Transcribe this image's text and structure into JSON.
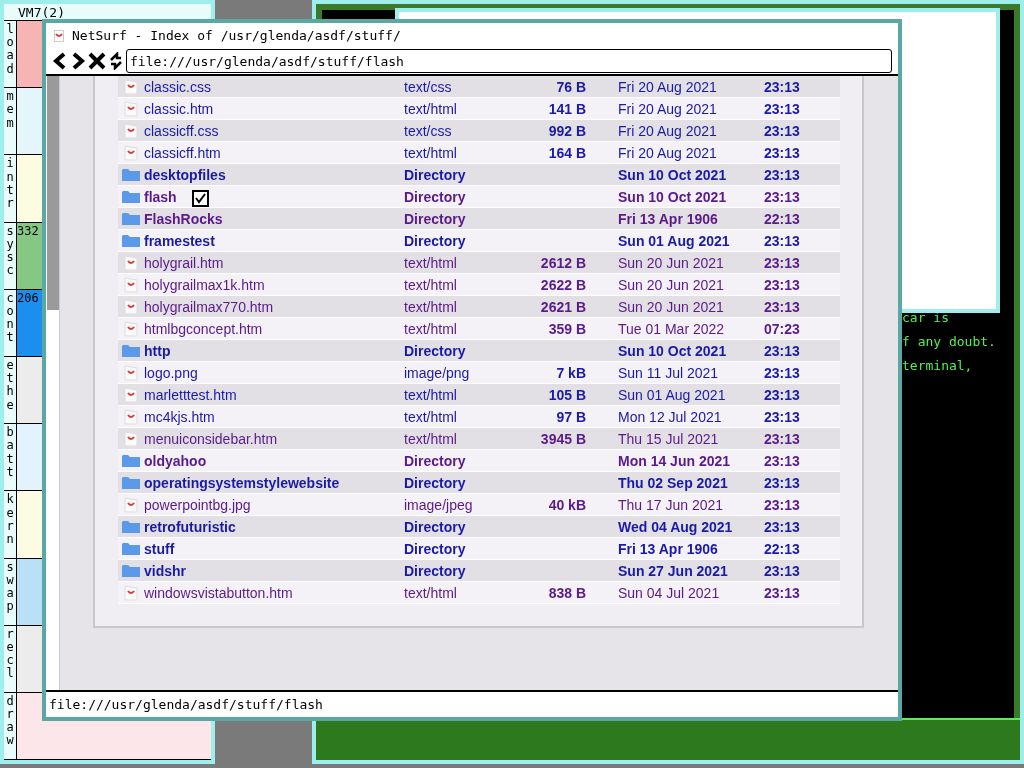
{
  "stats_window": {
    "title": "VM7(2)",
    "meters": [
      {
        "label": "load",
        "color": "#f7b4b4"
      },
      {
        "label": "mem",
        "color": "#e4f6fc"
      },
      {
        "label": "intr",
        "color": "#fdfbe0"
      },
      {
        "label": "sysc",
        "color": "#84c884",
        "reading": "332"
      },
      {
        "label": "cont",
        "color": "#1a8ff0",
        "reading": "206"
      },
      {
        "label": "ethe",
        "color": "#ececec"
      },
      {
        "label": "batt",
        "color": "#e2f3fd"
      },
      {
        "label": "kern",
        "color": "#fdfbe4"
      },
      {
        "label": "swap",
        "color": "#b9e0f7"
      },
      {
        "label": "recl",
        "color": "#ececec"
      },
      {
        "label": "draw",
        "color": "#fde6ea"
      }
    ]
  },
  "terminal": {
    "lines": [
      "car is",
      "f any doubt.",
      "terminal,"
    ]
  },
  "browser": {
    "title": "NetSurf - Index of /usr/glenda/asdf/stuff/",
    "url": "file:///usr/glenda/asdf/stuff/flash",
    "rows": [
      {
        "kind": "file",
        "name": "classic.css",
        "type": "text/css",
        "size": "76 B",
        "date": "Fri 20 Aug 2021",
        "time": "23:13",
        "visited": false
      },
      {
        "kind": "file",
        "name": "classic.htm",
        "type": "text/html",
        "size": "141 B",
        "date": "Fri 20 Aug 2021",
        "time": "23:13",
        "visited": false
      },
      {
        "kind": "file",
        "name": "classicff.css",
        "type": "text/css",
        "size": "992 B",
        "date": "Fri 20 Aug 2021",
        "time": "23:13",
        "visited": false
      },
      {
        "kind": "file",
        "name": "classicff.htm",
        "type": "text/html",
        "size": "164 B",
        "date": "Fri 20 Aug 2021",
        "time": "23:13",
        "visited": false
      },
      {
        "kind": "directory",
        "name": "desktopfiles",
        "type": "Directory",
        "date": "Sun 10 Oct 2021",
        "time": "23:13",
        "visited": false
      },
      {
        "kind": "directory",
        "name": "flash",
        "type": "Directory",
        "date": "Sun 10 Oct 2021",
        "time": "23:13",
        "visited": true
      },
      {
        "kind": "directory",
        "name": "FlashRocks",
        "type": "Directory",
        "date": "Fri 13 Apr 1906",
        "time": "22:13",
        "visited": true
      },
      {
        "kind": "directory",
        "name": "framestest",
        "type": "Directory",
        "date": "Sun 01 Aug 2021",
        "time": "23:13",
        "visited": false
      },
      {
        "kind": "file",
        "name": "holygrail.htm",
        "type": "text/html",
        "size": "2612 B",
        "date": "Sun 20 Jun 2021",
        "time": "23:13",
        "visited": true
      },
      {
        "kind": "file",
        "name": "holygrailmax1k.htm",
        "type": "text/html",
        "size": "2622 B",
        "date": "Sun 20 Jun 2021",
        "time": "23:13",
        "visited": true
      },
      {
        "kind": "file",
        "name": "holygrailmax770.htm",
        "type": "text/html",
        "size": "2621 B",
        "date": "Sun 20 Jun 2021",
        "time": "23:13",
        "visited": true
      },
      {
        "kind": "file",
        "name": "htmlbgconcept.htm",
        "type": "text/html",
        "size": "359 B",
        "date": "Tue 01 Mar 2022",
        "time": "07:23",
        "visited": true
      },
      {
        "kind": "directory",
        "name": "http",
        "type": "Directory",
        "date": "Sun 10 Oct 2021",
        "time": "23:13",
        "visited": false
      },
      {
        "kind": "file",
        "name": "logo.png",
        "type": "image/png",
        "size": "7 kB",
        "date": "Sun 11 Jul 2021",
        "time": "23:13",
        "visited": false
      },
      {
        "kind": "file",
        "name": "marletttest.htm",
        "type": "text/html",
        "size": "105 B",
        "date": "Sun 01 Aug 2021",
        "time": "23:13",
        "visited": false
      },
      {
        "kind": "file",
        "name": "mc4kjs.htm",
        "type": "text/html",
        "size": "97 B",
        "date": "Mon 12 Jul 2021",
        "time": "23:13",
        "visited": false
      },
      {
        "kind": "file",
        "name": "menuiconsidebar.htm",
        "type": "text/html",
        "size": "3945 B",
        "date": "Thu 15 Jul 2021",
        "time": "23:13",
        "visited": true
      },
      {
        "kind": "directory",
        "name": "oldyahoo",
        "type": "Directory",
        "date": "Mon 14 Jun 2021",
        "time": "23:13",
        "visited": true
      },
      {
        "kind": "directory",
        "name": "operatingsystemstylewebsite",
        "type": "Directory",
        "date": "Thu 02 Sep 2021",
        "time": "23:13",
        "visited": false
      },
      {
        "kind": "file",
        "name": "powerpointbg.jpg",
        "type": "image/jpeg",
        "size": "40 kB",
        "date": "Thu 17 Jun 2021",
        "time": "23:13",
        "visited": true
      },
      {
        "kind": "directory",
        "name": "retrofuturistic",
        "type": "Directory",
        "date": "Wed 04 Aug 2021",
        "time": "23:13",
        "visited": false
      },
      {
        "kind": "directory",
        "name": "stuff",
        "type": "Directory",
        "date": "Fri 13 Apr 1906",
        "time": "22:13",
        "visited": false
      },
      {
        "kind": "directory",
        "name": "vidshr",
        "type": "Directory",
        "date": "Sun 27 Jun 2021",
        "time": "23:13",
        "visited": false
      },
      {
        "kind": "file",
        "name": "windowsvistabutton.htm",
        "type": "text/html",
        "size": "838 B",
        "date": "Sun 04 Jul 2021",
        "time": "23:13",
        "visited": true
      }
    ],
    "status": "file:///usr/glenda/asdf/stuff/flash"
  }
}
